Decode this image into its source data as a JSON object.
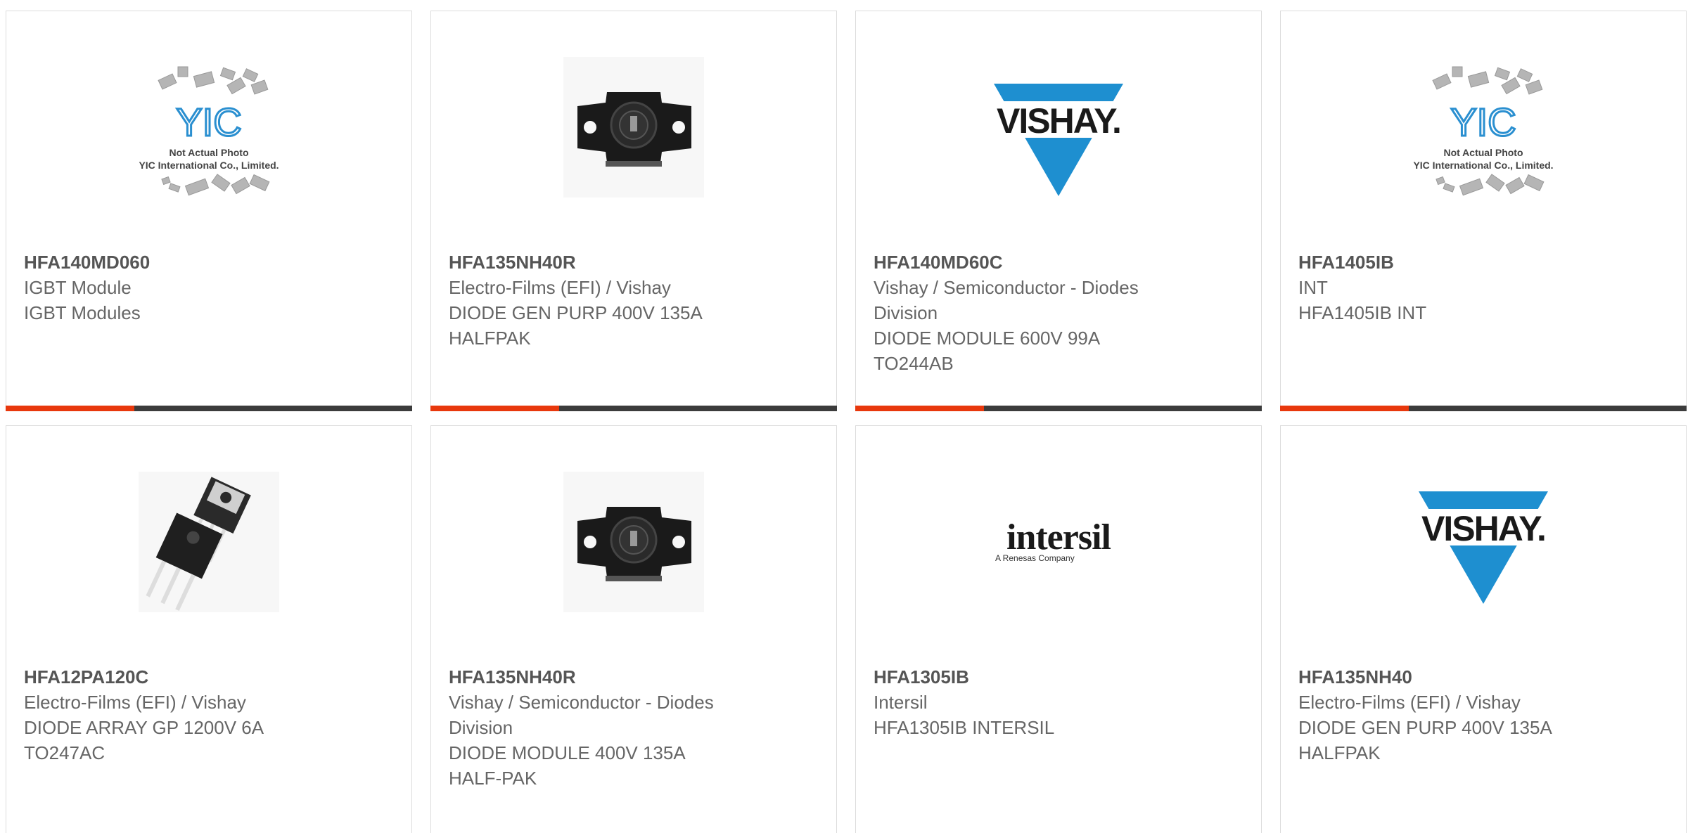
{
  "colors": {
    "accent": "#e8380d",
    "bar": "#3c3c3c",
    "vishay_blue": "#1e8fd0"
  },
  "products": [
    {
      "part": "HFA140MD060",
      "lines": [
        "IGBT Module",
        "IGBT Modules"
      ],
      "image": "yic-placeholder",
      "placeholder_text": [
        "Not Actual Photo",
        "YIC International Co., Limited."
      ],
      "logo_text": "YIC"
    },
    {
      "part": "HFA135NH40R",
      "lines": [
        "Electro-Films (EFI) / Vishay",
        "DIODE GEN PURP 400V 135A",
        "HALFPAK"
      ],
      "image": "halfpak-module"
    },
    {
      "part": "HFA140MD60C",
      "lines": [
        "Vishay / Semiconductor - Diodes",
        "Division",
        "DIODE MODULE 600V 99A",
        "TO244AB"
      ],
      "image": "vishay-logo",
      "logo_text": "VISHAY."
    },
    {
      "part": "HFA1405IB",
      "lines": [
        "INT",
        "HFA1405IB INT"
      ],
      "image": "yic-placeholder",
      "placeholder_text": [
        "Not Actual Photo",
        "YIC International Co., Limited."
      ],
      "logo_text": "YIC"
    },
    {
      "part": "HFA12PA120C",
      "lines": [
        "Electro-Films (EFI) / Vishay",
        "DIODE ARRAY GP 1200V 6A",
        "TO247AC"
      ],
      "image": "to247-package"
    },
    {
      "part": "HFA135NH40R",
      "lines": [
        "Vishay / Semiconductor - Diodes",
        "Division",
        "DIODE MODULE 400V 135A",
        "HALF-PAK"
      ],
      "image": "halfpak-module"
    },
    {
      "part": "HFA1305IB",
      "lines": [
        "Intersil",
        "HFA1305IB INTERSIL"
      ],
      "image": "intersil-logo",
      "logo_text": "intersil",
      "logo_sub": "A Renesas Company"
    },
    {
      "part": "HFA135NH40",
      "lines": [
        "Electro-Films (EFI) / Vishay",
        "DIODE GEN PURP 400V 135A",
        "HALFPAK"
      ],
      "image": "vishay-logo",
      "logo_text": "VISHAY."
    }
  ]
}
